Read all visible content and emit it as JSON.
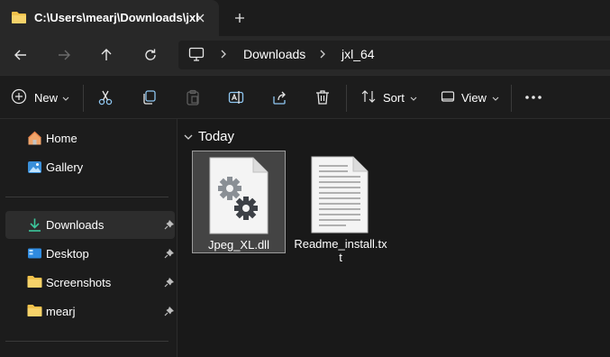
{
  "tab": {
    "title": "C:\\Users\\mearj\\Downloads\\jxl",
    "folder_icon": "folder-icon",
    "close_icon": "close-icon",
    "new_tab_icon": "plus-icon"
  },
  "nav": {
    "back_icon": "arrow-left-icon",
    "forward_icon": "arrow-right-icon",
    "up_icon": "arrow-up-icon",
    "refresh_icon": "refresh-icon",
    "breadcrumb": [
      "Downloads",
      "jxl_64"
    ]
  },
  "toolbar": {
    "new_label": "New",
    "sort_label": "Sort",
    "view_label": "View",
    "icons": [
      "cut-icon",
      "copy-icon",
      "paste-icon",
      "rename-icon",
      "share-icon",
      "delete-icon",
      "more-icon"
    ]
  },
  "sidebar": {
    "items": [
      {
        "label": "Home",
        "icon": "home-icon"
      },
      {
        "label": "Gallery",
        "icon": "gallery-icon"
      },
      {
        "label": "Downloads",
        "icon": "download-icon",
        "pinned": true,
        "selected": true
      },
      {
        "label": "Desktop",
        "icon": "desktop-icon",
        "pinned": true
      },
      {
        "label": "Screenshots",
        "icon": "folder-icon",
        "pinned": true
      },
      {
        "label": "mearj",
        "icon": "folder-icon",
        "pinned": true
      }
    ]
  },
  "main": {
    "group_header": "Today",
    "files": [
      {
        "name": "Jpeg_XL.dll",
        "icon": "dll-file-icon",
        "selected": true
      },
      {
        "name_line1": "Readme_install.tx",
        "name_line2": "t",
        "icon": "text-file-icon"
      }
    ]
  },
  "colors": {
    "background": "#191919",
    "chrome": "#282828",
    "selection": "#444444",
    "download_accent": "#3cc69b",
    "folder": "#f0c14b"
  }
}
